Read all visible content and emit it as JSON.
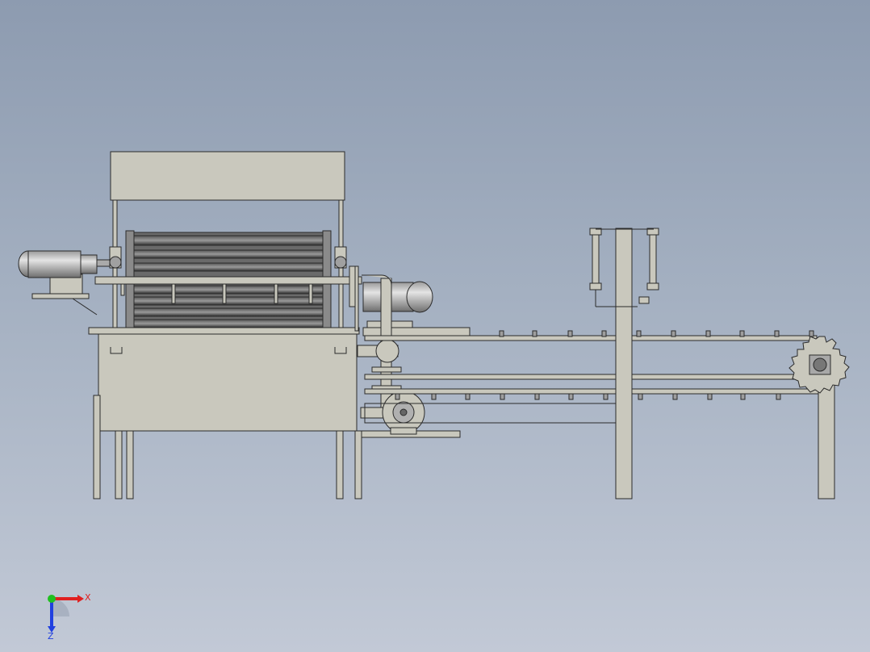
{
  "viewport": {
    "background_top": "#8d9bb0",
    "background_bottom": "#c2c9d6"
  },
  "model": {
    "part_fill": "#c9c8bd",
    "part_stroke": "#2b2b2b",
    "roller_dark": "#3a3a3a",
    "motor_fill": "#b8b8b8"
  },
  "triad": {
    "x_label": "X",
    "z_label": "Z",
    "x_color": "#e02020",
    "y_color": "#20c020",
    "z_color": "#2040e0"
  }
}
